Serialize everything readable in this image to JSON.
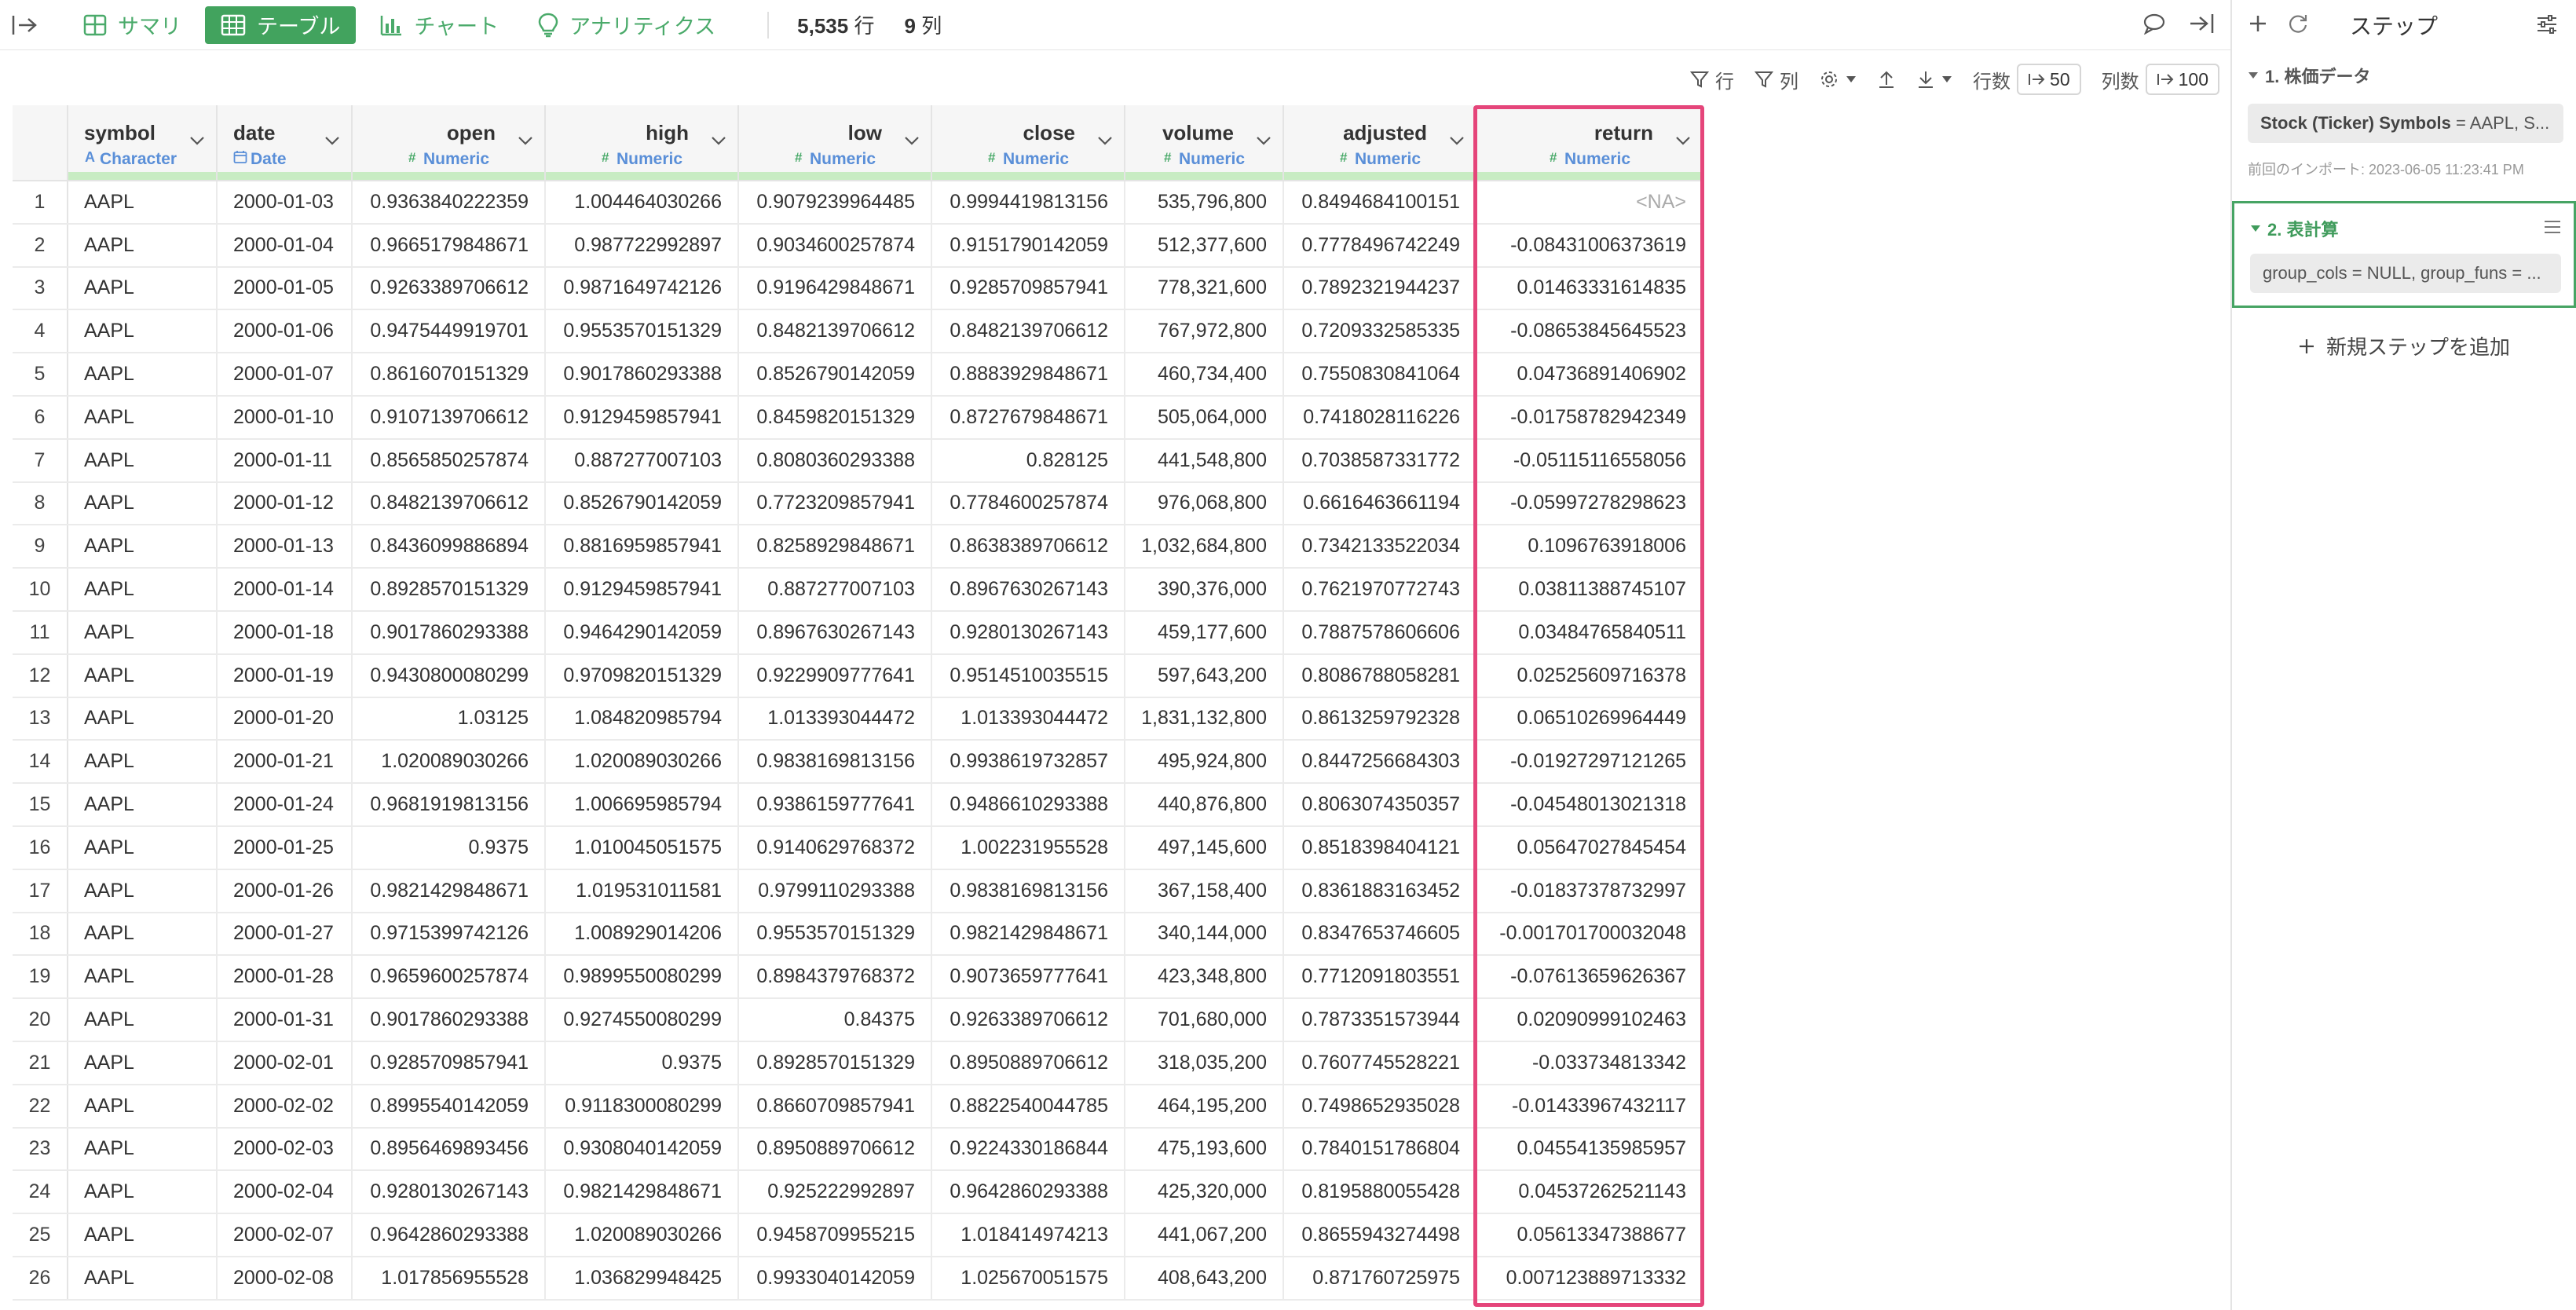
{
  "toolbar": {
    "tabs": [
      {
        "label": "サマリ",
        "icon": "summary-grid-icon",
        "active": false
      },
      {
        "label": "テーブル",
        "icon": "table-icon",
        "active": true
      },
      {
        "label": "チャート",
        "icon": "bar-chart-icon",
        "active": false
      },
      {
        "label": "アナリティクス",
        "icon": "lightbulb-icon",
        "active": false
      }
    ],
    "row_count": "5,535",
    "row_unit": "行",
    "col_count": "9",
    "col_unit": "列"
  },
  "grid_tools": {
    "filter_rows": "行",
    "filter_cols": "列",
    "rows_label": "行数",
    "rows_value": "50",
    "cols_label": "列数",
    "cols_value": "100"
  },
  "table": {
    "columns": [
      {
        "name": "symbol",
        "type": "Character",
        "type_icon": "character-type-icon"
      },
      {
        "name": "date",
        "type": "Date",
        "type_icon": "calendar-icon"
      },
      {
        "name": "open",
        "type": "Numeric",
        "type_icon": "numeric-hash-icon"
      },
      {
        "name": "high",
        "type": "Numeric",
        "type_icon": "numeric-hash-icon"
      },
      {
        "name": "low",
        "type": "Numeric",
        "type_icon": "numeric-hash-icon"
      },
      {
        "name": "close",
        "type": "Numeric",
        "type_icon": "numeric-hash-icon"
      },
      {
        "name": "volume",
        "type": "Numeric",
        "type_icon": "numeric-hash-icon"
      },
      {
        "name": "adjusted",
        "type": "Numeric",
        "type_icon": "numeric-hash-icon"
      },
      {
        "name": "return",
        "type": "Numeric",
        "type_icon": "numeric-hash-icon"
      }
    ],
    "rows": [
      [
        "1",
        "AAPL",
        "2000-01-03",
        "0.9363840222359",
        "1.004464030266",
        "0.9079239964485",
        "0.9994419813156",
        "535,796,800",
        "0.8494684100151",
        "<NA>"
      ],
      [
        "2",
        "AAPL",
        "2000-01-04",
        "0.9665179848671",
        "0.987722992897",
        "0.9034600257874",
        "0.9151790142059",
        "512,377,600",
        "0.7778496742249",
        "-0.08431006373619"
      ],
      [
        "3",
        "AAPL",
        "2000-01-05",
        "0.9263389706612",
        "0.9871649742126",
        "0.9196429848671",
        "0.9285709857941",
        "778,321,600",
        "0.7892321944237",
        "0.01463331614835"
      ],
      [
        "4",
        "AAPL",
        "2000-01-06",
        "0.9475449919701",
        "0.9553570151329",
        "0.8482139706612",
        "0.8482139706612",
        "767,972,800",
        "0.7209332585335",
        "-0.08653845645523"
      ],
      [
        "5",
        "AAPL",
        "2000-01-07",
        "0.8616070151329",
        "0.9017860293388",
        "0.8526790142059",
        "0.8883929848671",
        "460,734,400",
        "0.7550830841064",
        "0.04736891406902"
      ],
      [
        "6",
        "AAPL",
        "2000-01-10",
        "0.9107139706612",
        "0.9129459857941",
        "0.8459820151329",
        "0.8727679848671",
        "505,064,000",
        "0.7418028116226",
        "-0.01758782942349"
      ],
      [
        "7",
        "AAPL",
        "2000-01-11",
        "0.8565850257874",
        "0.887277007103",
        "0.8080360293388",
        "0.828125",
        "441,548,800",
        "0.7038587331772",
        "-0.05115116558056"
      ],
      [
        "8",
        "AAPL",
        "2000-01-12",
        "0.8482139706612",
        "0.8526790142059",
        "0.7723209857941",
        "0.7784600257874",
        "976,068,800",
        "0.6616463661194",
        "-0.05997278298623"
      ],
      [
        "9",
        "AAPL",
        "2000-01-13",
        "0.8436099886894",
        "0.8816959857941",
        "0.8258929848671",
        "0.8638389706612",
        "1,032,684,800",
        "0.7342133522034",
        "0.1096763918006"
      ],
      [
        "10",
        "AAPL",
        "2000-01-14",
        "0.8928570151329",
        "0.9129459857941",
        "0.887277007103",
        "0.8967630267143",
        "390,376,000",
        "0.7621970772743",
        "0.03811388745107"
      ],
      [
        "11",
        "AAPL",
        "2000-01-18",
        "0.9017860293388",
        "0.9464290142059",
        "0.8967630267143",
        "0.9280130267143",
        "459,177,600",
        "0.7887578606606",
        "0.03484765840511"
      ],
      [
        "12",
        "AAPL",
        "2000-01-19",
        "0.9430800080299",
        "0.9709820151329",
        "0.9229909777641",
        "0.9514510035515",
        "597,643,200",
        "0.8086788058281",
        "0.02525609716378"
      ],
      [
        "13",
        "AAPL",
        "2000-01-20",
        "1.03125",
        "1.084820985794",
        "1.013393044472",
        "1.013393044472",
        "1,831,132,800",
        "0.8613259792328",
        "0.06510269964449"
      ],
      [
        "14",
        "AAPL",
        "2000-01-21",
        "1.020089030266",
        "1.020089030266",
        "0.9838169813156",
        "0.9938619732857",
        "495,924,800",
        "0.8447256684303",
        "-0.01927297121265"
      ],
      [
        "15",
        "AAPL",
        "2000-01-24",
        "0.9681919813156",
        "1.006695985794",
        "0.9386159777641",
        "0.9486610293388",
        "440,876,800",
        "0.8063074350357",
        "-0.04548013021318"
      ],
      [
        "16",
        "AAPL",
        "2000-01-25",
        "0.9375",
        "1.010045051575",
        "0.9140629768372",
        "1.002231955528",
        "497,145,600",
        "0.8518398404121",
        "0.05647027845454"
      ],
      [
        "17",
        "AAPL",
        "2000-01-26",
        "0.9821429848671",
        "1.019531011581",
        "0.9799110293388",
        "0.9838169813156",
        "367,158,400",
        "0.8361883163452",
        "-0.01837378732997"
      ],
      [
        "18",
        "AAPL",
        "2000-01-27",
        "0.9715399742126",
        "1.008929014206",
        "0.9553570151329",
        "0.9821429848671",
        "340,144,000",
        "0.8347653746605",
        "-0.001701700032048"
      ],
      [
        "19",
        "AAPL",
        "2000-01-28",
        "0.9659600257874",
        "0.9899550080299",
        "0.8984379768372",
        "0.9073659777641",
        "423,348,800",
        "0.7712091803551",
        "-0.07613659626367"
      ],
      [
        "20",
        "AAPL",
        "2000-01-31",
        "0.9017860293388",
        "0.9274550080299",
        "0.84375",
        "0.9263389706612",
        "701,680,000",
        "0.7873351573944",
        "0.02090999102463"
      ],
      [
        "21",
        "AAPL",
        "2000-02-01",
        "0.9285709857941",
        "0.9375",
        "0.8928570151329",
        "0.8950889706612",
        "318,035,200",
        "0.7607745528221",
        "-0.033734813342"
      ],
      [
        "22",
        "AAPL",
        "2000-02-02",
        "0.8995540142059",
        "0.9118300080299",
        "0.8660709857941",
        "0.8822540044785",
        "464,195,200",
        "0.7498652935028",
        "-0.01433967432117"
      ],
      [
        "23",
        "AAPL",
        "2000-02-03",
        "0.8956469893456",
        "0.9308040142059",
        "0.8950889706612",
        "0.9224330186844",
        "475,193,600",
        "0.7840151786804",
        "0.04554135985957"
      ],
      [
        "24",
        "AAPL",
        "2000-02-04",
        "0.9280130267143",
        "0.9821429848671",
        "0.925222992897",
        "0.9642860293388",
        "425,320,000",
        "0.8195880055428",
        "0.04537262521143"
      ],
      [
        "25",
        "AAPL",
        "2000-02-07",
        "0.9642860293388",
        "1.020089030266",
        "0.9458709955215",
        "1.018414974213",
        "441,067,200",
        "0.8655943274498",
        "0.05613347388677"
      ],
      [
        "26",
        "AAPL",
        "2000-02-08",
        "1.017856955528",
        "1.036829948425",
        "0.9933040142059",
        "1.025670051575",
        "408,643,200",
        "0.871760725975",
        "0.007123889713332"
      ]
    ]
  },
  "panel": {
    "title": "ステップ",
    "steps": [
      {
        "title": "1. 株価データ",
        "chip_key": "Stock (Ticker) Symbols",
        "chip_rest": " = AAPL, S...",
        "meta": "前回のインポート: 2023-06-05 11:23:41 PM"
      },
      {
        "title": "2. 表計算",
        "chip_key": "",
        "chip_rest": "group_cols = NULL, group_funs = ..."
      }
    ],
    "add_step": "新規ステップを追加"
  },
  "colors": {
    "accent_green": "#42a35e",
    "highlight_pink": "#e5457a",
    "type_blue": "#5a8fd8",
    "header_bar": "#c8ecc3"
  }
}
